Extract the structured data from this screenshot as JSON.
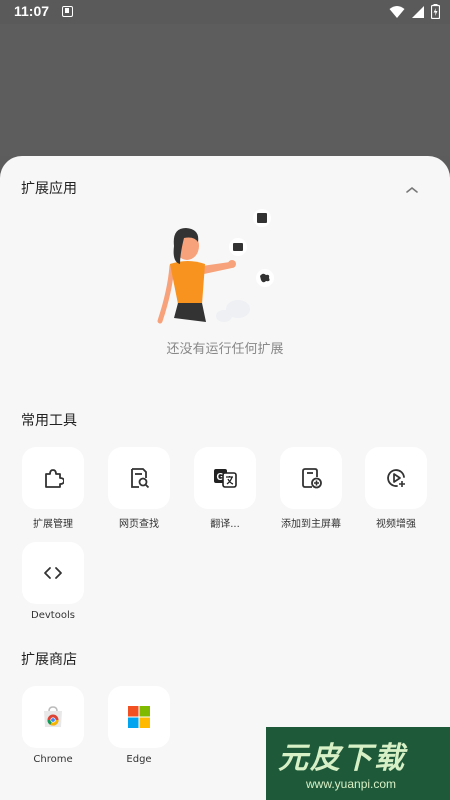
{
  "status_bar": {
    "time": "11:07"
  },
  "sheet": {
    "extensions": {
      "title": "扩展应用",
      "empty_text": "还没有运行任何扩展"
    },
    "common_tools": {
      "title": "常用工具",
      "items": [
        {
          "label": "扩展管理",
          "icon": "puzzle-icon"
        },
        {
          "label": "网页查找",
          "icon": "page-search-icon"
        },
        {
          "label": "翻译...",
          "icon": "translate-icon"
        },
        {
          "label": "添加到主屏幕",
          "icon": "add-to-home-icon"
        },
        {
          "label": "视频增强",
          "icon": "video-enhance-icon"
        },
        {
          "label": "Devtools",
          "icon": "code-icon"
        }
      ]
    },
    "store": {
      "title": "扩展商店",
      "items": [
        {
          "label": "Chrome",
          "icon": "chrome-store-icon"
        },
        {
          "label": "Edge",
          "icon": "edge-store-icon"
        }
      ]
    }
  },
  "watermark": {
    "title": "元皮下载",
    "url": "www.yuanpi.com"
  }
}
